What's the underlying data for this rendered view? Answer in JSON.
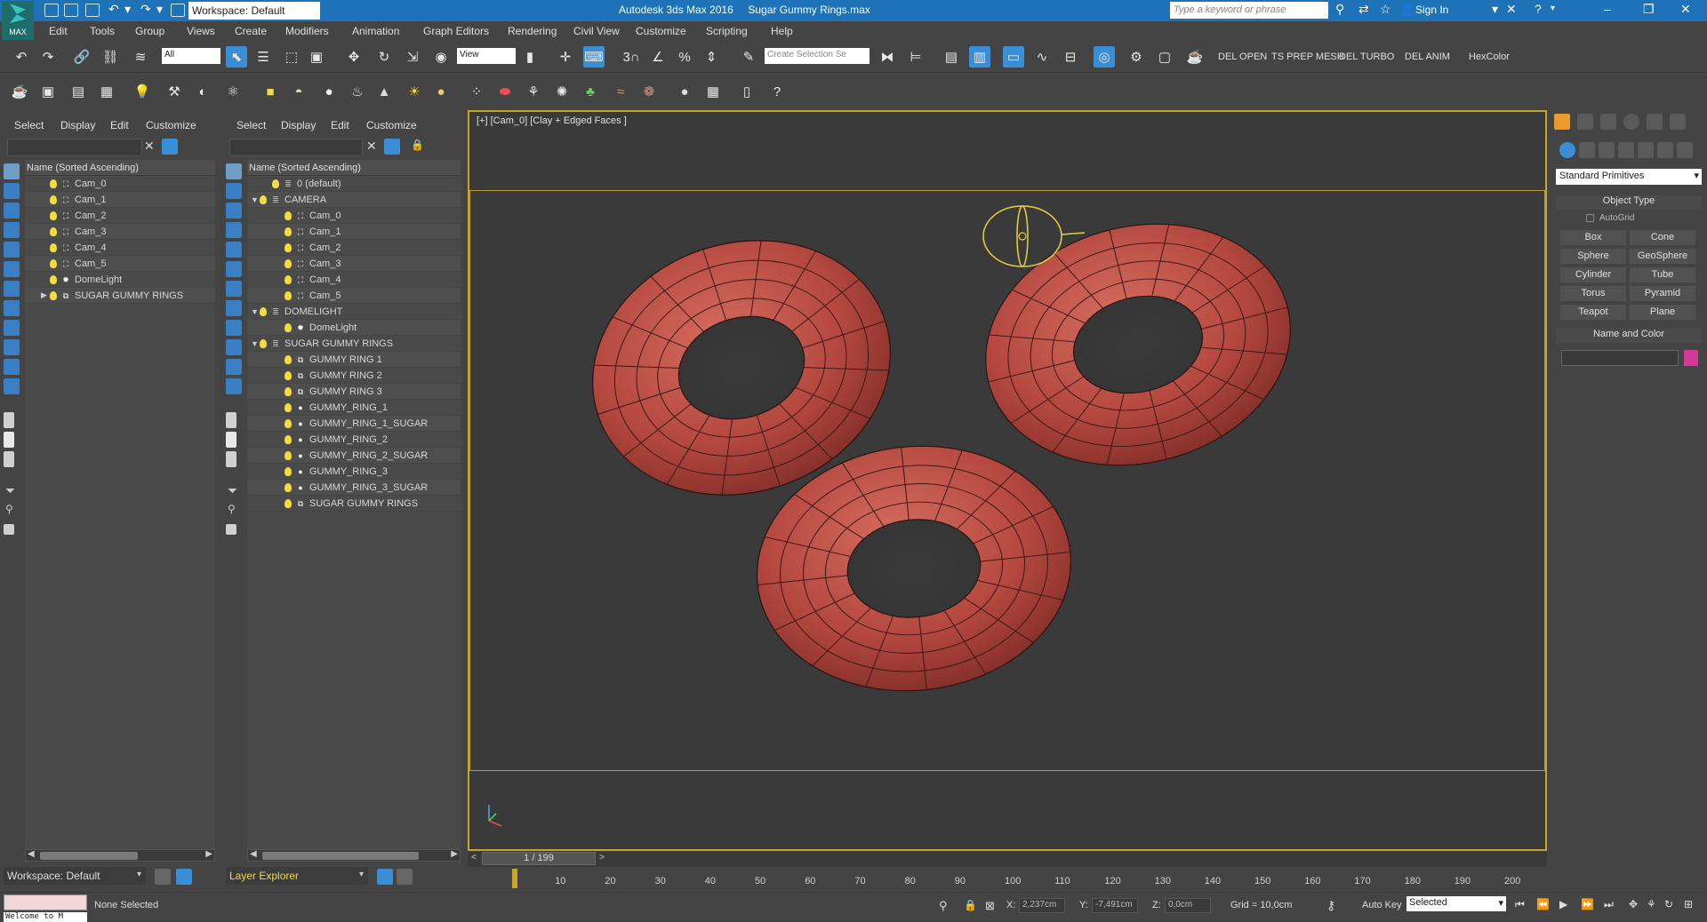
{
  "titlebar": {
    "app_logo": "MAX",
    "workspace": "Workspace: Default",
    "title": "Autodesk 3ds Max 2016     Sugar Gummy Rings.max",
    "search_placeholder": "Type a keyword or phrase",
    "sign_in": "Sign In"
  },
  "menu": [
    "Edit",
    "Tools",
    "Group",
    "Views",
    "Create",
    "Modifiers",
    "Animation",
    "Graph Editors",
    "Rendering",
    "Civil View",
    "Customize",
    "Scripting",
    "Help"
  ],
  "toolbar": {
    "selection_filter": "All",
    "ref_coord": "View",
    "selection_set": "Create Selection Se",
    "num_3": "3",
    "custom_buttons": [
      "DEL OPEN",
      "TS PREP MESH",
      "DEL TURBO",
      "DEL ANIM",
      "HexColor"
    ]
  },
  "explorer_left": {
    "menu": [
      "Select",
      "Display",
      "Edit",
      "Customize"
    ],
    "header": "Name (Sorted Ascending)",
    "rows": [
      {
        "label": "Cam_0",
        "icon": "camera"
      },
      {
        "label": "Cam_1",
        "icon": "camera"
      },
      {
        "label": "Cam_2",
        "icon": "camera"
      },
      {
        "label": "Cam_3",
        "icon": "camera"
      },
      {
        "label": "Cam_4",
        "icon": "camera"
      },
      {
        "label": "Cam_5",
        "icon": "camera"
      },
      {
        "label": "DomeLight",
        "icon": "light"
      },
      {
        "label": "SUGAR GUMMY RINGS",
        "icon": "group",
        "expand": "▶"
      }
    ],
    "workspace": "Workspace: Default"
  },
  "explorer_right": {
    "menu": [
      "Select",
      "Display",
      "Edit",
      "Customize"
    ],
    "header": "Name (Sorted Ascending)",
    "rows": [
      {
        "label": "0 (default)",
        "indent": 1,
        "icon": "layer"
      },
      {
        "label": "CAMERA",
        "indent": 0,
        "icon": "layer",
        "expand": "▼"
      },
      {
        "label": "Cam_0",
        "indent": 2,
        "icon": "camera"
      },
      {
        "label": "Cam_1",
        "indent": 2,
        "icon": "camera"
      },
      {
        "label": "Cam_2",
        "indent": 2,
        "icon": "camera"
      },
      {
        "label": "Cam_3",
        "indent": 2,
        "icon": "camera"
      },
      {
        "label": "Cam_4",
        "indent": 2,
        "icon": "camera"
      },
      {
        "label": "Cam_5",
        "indent": 2,
        "icon": "camera"
      },
      {
        "label": "DOMELIGHT",
        "indent": 0,
        "icon": "layer",
        "expand": "▼"
      },
      {
        "label": "DomeLight",
        "indent": 2,
        "icon": "light"
      },
      {
        "label": "SUGAR GUMMY RINGS",
        "indent": 0,
        "icon": "layer",
        "expand": "▼"
      },
      {
        "label": "GUMMY RING 1",
        "indent": 2,
        "icon": "group"
      },
      {
        "label": "GUMMY RING 2",
        "indent": 2,
        "icon": "group"
      },
      {
        "label": "GUMMY RING 3",
        "indent": 2,
        "icon": "group"
      },
      {
        "label": "GUMMY_RING_1",
        "indent": 2,
        "icon": "geo"
      },
      {
        "label": "GUMMY_RING_1_SUGAR",
        "indent": 2,
        "icon": "geo"
      },
      {
        "label": "GUMMY_RING_2",
        "indent": 2,
        "icon": "geo"
      },
      {
        "label": "GUMMY_RING_2_SUGAR",
        "indent": 2,
        "icon": "geo"
      },
      {
        "label": "GUMMY_RING_3",
        "indent": 2,
        "icon": "geo"
      },
      {
        "label": "GUMMY_RING_3_SUGAR",
        "indent": 2,
        "icon": "geo"
      },
      {
        "label": "SUGAR GUMMY RINGS",
        "indent": 2,
        "icon": "group"
      }
    ],
    "explorer_name": "Layer Explorer"
  },
  "viewport": {
    "label": "[+] [Cam_0] [Clay + Edged Faces ]"
  },
  "command_panel": {
    "category": "Standard Primitives",
    "object_type_title": "Object Type",
    "autogrid": "AutoGrid",
    "buttons": [
      "Box",
      "Cone",
      "Sphere",
      "GeoSphere",
      "Cylinder",
      "Tube",
      "Torus",
      "Pyramid",
      "Teapot",
      "Plane"
    ],
    "name_color_title": "Name and Color",
    "swatch_color": "#d4399a"
  },
  "timeline": {
    "frame": "1 / 199",
    "frame_current": 1,
    "frame_total": 199,
    "ticks": [
      "10",
      "20",
      "30",
      "40",
      "50",
      "60",
      "70",
      "80",
      "90",
      "100",
      "110",
      "120",
      "130",
      "140",
      "150",
      "160",
      "170",
      "180",
      "190",
      "200"
    ]
  },
  "status": {
    "maxscript": "Welcome to M",
    "selection": "None Selected",
    "x_label": "X:",
    "x": "2,237cm",
    "y_label": "Y:",
    "y": "-7,491cm",
    "z_label": "Z:",
    "z": "0,0cm",
    "grid": "Grid = 10,0cm",
    "auto_key": "Auto Key",
    "set_key_mode": "Selected"
  },
  "colors": {
    "title_blue": "#1e73b8",
    "accent_blue": "#3a8ed6",
    "ring_red": "#c0524a",
    "viewport_border": "#c8a628"
  }
}
